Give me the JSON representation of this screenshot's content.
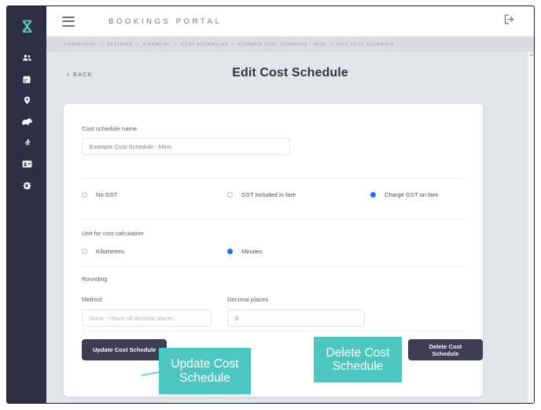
{
  "app": {
    "brand": "BOOKINGS PORTAL",
    "accent_teal": "#4cc6c0",
    "sidebar_color": "#2e2e44",
    "button_color": "#3d3d55",
    "radio_selected_color": "#1a73e8"
  },
  "topbar": {
    "menu_icon": "hamburger-icon",
    "logout_icon": "logout-icon"
  },
  "sidebar": {
    "logo_icon": "app-logo-icon",
    "items": [
      {
        "icon": "people-icon",
        "label": "People"
      },
      {
        "icon": "calendar-icon",
        "label": "Calendar"
      },
      {
        "icon": "location-pin-icon",
        "label": "Locations"
      },
      {
        "icon": "car-icon",
        "label": "Vehicles"
      },
      {
        "icon": "runner-icon",
        "label": "Activity"
      },
      {
        "icon": "id-card-icon",
        "label": "Accounts"
      },
      {
        "icon": "gear-icon",
        "label": "Settings"
      }
    ]
  },
  "breadcrumb": {
    "separator": ">",
    "items": [
      "DASHBOARD",
      "SETTINGS",
      "FINANCIAL",
      "COST SCHEDULES",
      "EXAMPLE COST SCHEDULE - MINS",
      "EDIT COST SCHEDULE"
    ]
  },
  "page": {
    "back_label": "BACK",
    "back_chevron": "‹",
    "title": "Edit Cost Schedule"
  },
  "form": {
    "name_field": {
      "label": "Cost schedule name",
      "value": "Example Cost Schedule - Mins"
    },
    "gst": {
      "options": [
        {
          "label": "No GST",
          "selected": false
        },
        {
          "label": "GST included in fare",
          "selected": false
        },
        {
          "label": "Charge GST on fare",
          "selected": true
        }
      ]
    },
    "unit": {
      "label": "Unit for cost calculation",
      "options": [
        {
          "label": "Kilometres",
          "selected": false
        },
        {
          "label": "Minutes",
          "selected": true
        }
      ]
    },
    "rounding": {
      "label": "Rounding",
      "method": {
        "label": "Method",
        "value": "",
        "placeholder": "None - return all decimal places."
      },
      "decimal_places": {
        "label": "Decimal places",
        "value": "0"
      }
    },
    "buttons": {
      "update": "Update Cost Schedule",
      "delete": "Delete Cost Schedule"
    }
  },
  "annotations": [
    {
      "text": "Update Cost Schedule",
      "target": "update-cost-schedule-button"
    },
    {
      "text": "Delete Cost Schedule",
      "target": "delete-cost-schedule-button"
    }
  ]
}
